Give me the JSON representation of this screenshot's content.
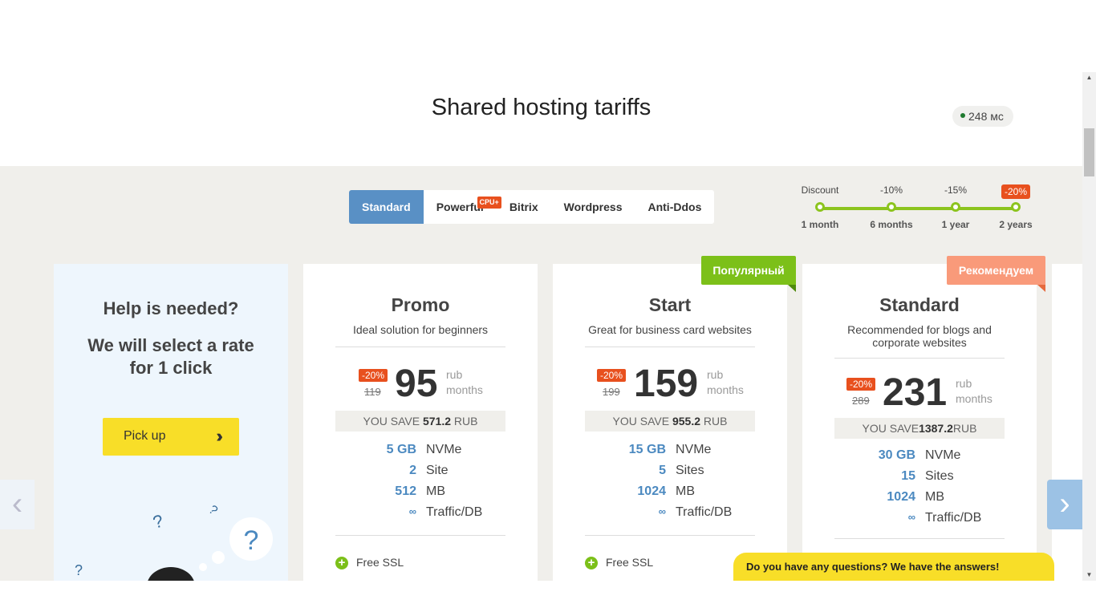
{
  "page": {
    "title": "Shared hosting tariffs",
    "ping": "248 мс"
  },
  "tabs": [
    {
      "label": "Standard"
    },
    {
      "label": "Powerful",
      "badge": "CPU+"
    },
    {
      "label": "Bitrix"
    },
    {
      "label": "Wordpress"
    },
    {
      "label": "Anti-Ddos"
    }
  ],
  "discount": {
    "label": "Discount",
    "steps": [
      {
        "top": "",
        "bottom": "1 month"
      },
      {
        "top": "-10%",
        "bottom": "6 months"
      },
      {
        "top": "-15%",
        "bottom": "1 year"
      },
      {
        "top": "-20%",
        "bottom": "2 years",
        "highlight": true
      }
    ]
  },
  "help": {
    "title": "Help is needed?",
    "subtitle_1": "We will select a rate",
    "subtitle_2": "for 1 click",
    "button": "Pick up"
  },
  "plans": [
    {
      "name": "Promo",
      "desc": "Ideal solution for beginners",
      "badge": "-20%",
      "old_price": "119",
      "price": "95",
      "unit_1": "rub",
      "unit_2": "months",
      "save_label": "YOU SAVE ",
      "save_value": "571.2",
      "save_unit": " RUB",
      "features": [
        {
          "num": "5 GB",
          "txt": "NVMe"
        },
        {
          "num": "2",
          "txt": "Site"
        },
        {
          "num": "512",
          "txt": "MB"
        },
        {
          "num": "∞",
          "txt": "Traffic/DB"
        }
      ],
      "extras": [
        "Free SSL"
      ]
    },
    {
      "name": "Start",
      "desc": "Great for business card websites",
      "badge": "-20%",
      "old_price": "199",
      "price": "159",
      "unit_1": "rub",
      "unit_2": "months",
      "save_label": "YOU SAVE ",
      "save_value": "955.2",
      "save_unit": " RUB",
      "ribbon": "Популярный",
      "features": [
        {
          "num": "15 GB",
          "txt": "NVMe"
        },
        {
          "num": "5",
          "txt": "Sites"
        },
        {
          "num": "1024",
          "txt": "MB"
        },
        {
          "num": "∞",
          "txt": "Traffic/DB"
        }
      ],
      "extras": [
        "Free SSL"
      ]
    },
    {
      "name": "Standard",
      "desc": "Recommended for blogs and corporate websites",
      "badge": "-20%",
      "old_price": "289",
      "price": "231",
      "unit_1": "rub",
      "unit_2": "months",
      "save_label": "YOU SAVE",
      "save_value": "1387.2",
      "save_unit": "RUB",
      "ribbon": "Рекомендуем",
      "features": [
        {
          "num": "30 GB",
          "txt": "NVMe"
        },
        {
          "num": "15",
          "txt": "Sites"
        },
        {
          "num": "1024",
          "txt": "MB"
        },
        {
          "num": "∞",
          "txt": "Traffic/DB"
        }
      ],
      "extras": []
    }
  ],
  "chat": {
    "label": "Do you have any questions? We have the answers!"
  },
  "colors": {
    "accent": "#5990c5",
    "green": "#8cc41e",
    "orange": "#e8501e",
    "yellow": "#f8de28",
    "salmon": "#f99a7a"
  }
}
